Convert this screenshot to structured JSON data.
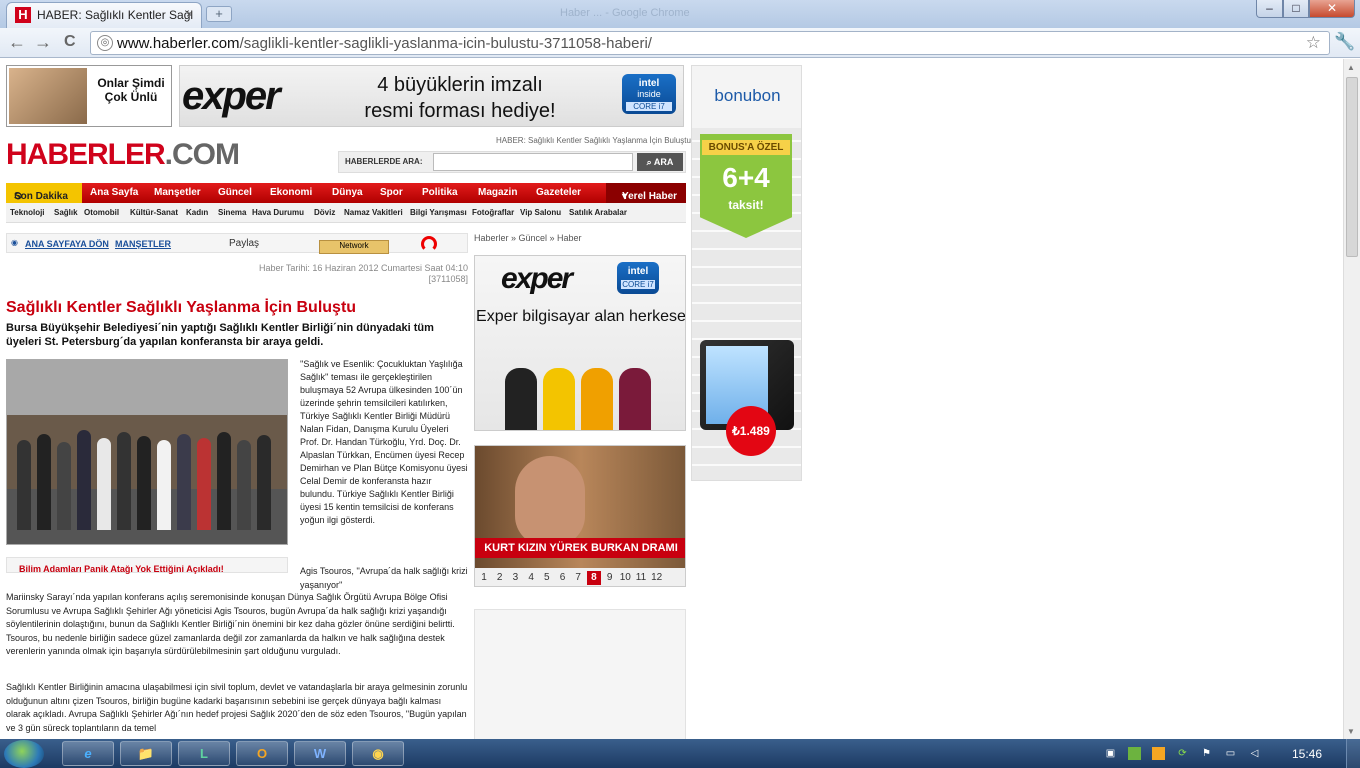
{
  "browser": {
    "tab_title": "HABER: Sağlıklı Kentler Sağl",
    "tab_close": "×",
    "new_tab": "+",
    "window_ghost_title": "Haber ... - Google Chrome",
    "url_host": "www.haberler.com",
    "url_path": "/saglikli-kentler-saglikli-yaslanma-icin-bulustu-3711058-haberi/",
    "back": "←",
    "forward": "→",
    "reload": "C",
    "star": "☆",
    "wrench": "🔧",
    "minimize": "–",
    "maximize": "□",
    "close": "✕"
  },
  "ads": {
    "baby_text": "Onlar Şimdi Çok Ünlü",
    "exper_logo": "exper",
    "exper_top_slogan": "4 büyüklerin imzalı resmi forması hediye!",
    "intel_brand": "intel",
    "intel_inside": "inside",
    "intel_core": "CORE i7",
    "bonubon_logo": "bonubon",
    "bonus_label": "BONUS'A ÖZEL",
    "bonus_num": "6+4",
    "bonus_sub": "taksit!",
    "price": "₺1.489",
    "exper_mid_slogan": "Exper bilgisayar alan herkese"
  },
  "header": {
    "crumb_top": "HABER: Sağlıklı Kentler Sağlıklı Yaşlanma İçin Buluştu",
    "logo_main": "HABERLER",
    "logo_dot": ".COM",
    "search_label": "HABERLERDE ARA:",
    "search_value": "",
    "search_button": "ARA"
  },
  "nav": {
    "breaking": "Son Dakika",
    "items": [
      "Ana Sayfa",
      "Manşetler",
      "Güncel",
      "Ekonomi",
      "Dünya",
      "Spor",
      "Politika",
      "Magazin",
      "Gazeteler"
    ],
    "local": "Yerel Haber",
    "sub_items": [
      "Teknoloji",
      "Sağlık",
      "Otomobil",
      "Kültür-Sanat",
      "Kadın",
      "Sinema",
      "Hava Durumu",
      "Döviz",
      "Namaz Vakitleri",
      "Bilgi Yarışması",
      "Fotoğraflar",
      "Vip Salonu",
      "Satılık Arabalar"
    ]
  },
  "article": {
    "back_home": "ANA SAYFAYA DÖN",
    "headlines_link": "MANŞETLER",
    "share": "Paylaş",
    "share_widget": "Network",
    "date": "Haber Tarihi: 16 Haziran 2012 Cumartesi Saat 04:10",
    "id": "[3711058]",
    "title": "Sağlıklı Kentler Sağlıklı Yaşlanma İçin Buluştu",
    "summary": "Bursa Büyükşehir Belediyesi´nin yaptığı Sağlıklı Kentler Birliği´nin dünyadaki tüm üyeleri St. Petersburg´da yapılan konferansta bir araya geldi.",
    "related": "Bilim Adamları Panik Atağı Yok Ettiğini Açıkladı!",
    "p1": "''Sağlık ve Esenlik: Çocukluktan Yaşlılığa Sağlık'' teması ile gerçekleştirilen buluşmaya 52 Avrupa ülkesinden 100´ün üzerinde şehrin temsilcileri katılırken, Türkiye Sağlıklı Kentler Birliği Müdürü Nalan Fidan, Danışma Kurulu Üyeleri Prof. Dr. Handan Türkoğlu, Yrd. Doç. Dr. Alpaslan Türkkan, Encümen üyesi Recep Demirhan ve Plan Bütçe Komisyonu üyesi Celal Demir de konferansta hazır bulundu. Türkiye Sağlıklı Kentler Birliği üyesi 15 kentin temsilcisi de konferans yoğun ilgi gösterdi.",
    "p2a": "Agis Tsouros, ''Avrupa´da halk sağlığı krizi yaşanıyor''",
    "p2b": "Mariinsky Sarayı´nda yapılan konferans açılış seremonisinde konuşan Dünya Sağlık Örgütü Avrupa Bölge Ofisi Sorumlusu ve Avrupa Sağlıklı Şehirler Ağı yöneticisi Agis Tsouros, bugün Avrupa´da halk sağlığı krizi yaşandığı söylentilerinin dolaştığını, bunun da Sağlıklı Kentler Birliği´nin önemini bir kez daha gözler önüne serdiğini belirtti. Tsouros, bu nedenle birliğin sadece güzel zamanlarda değil zor zamanlarda da halkın ve halk sağlığına destek verenlerin yanında olmak için başarıyla sürdürülebilmesinin şart olduğunu vurguladı.",
    "p3": "Sağlıklı Kentler Birliğinin amacına ulaşabilmesi için sivil toplum, devlet ve vatandaşlarla bir araya gelmesinin zorunlu olduğunun altını çizen Tsouros, birliğin bugüne kadarki başarısının sebebini ise gerçek dünyaya bağlı kalması olarak açıkladı. Avrupa Sağlıklı Şehirler Ağı´nın hedef projesi Sağlık 2020´den de söz eden Tsouros, \"Bugün yapılan ve 3 gün süreck toplantıların da temel"
  },
  "middle": {
    "crumb": "Haberler » Güncel » Haber",
    "gallery_caption": "KURT KIZIN YÜREK BURKAN DRAMI",
    "pages": [
      "1",
      "2",
      "3",
      "4",
      "5",
      "6",
      "7",
      "8",
      "9",
      "10",
      "11",
      "12"
    ],
    "active_page": "8"
  },
  "taskbar": {
    "clock": "15:46",
    "apps": [
      "e",
      "📁",
      "L",
      "O",
      "W",
      "◉"
    ]
  },
  "colors": {
    "brand_red": "#d0021b",
    "nav_red": "#c8000f",
    "breaking_yellow": "#f4c400",
    "link_blue": "#1a4f9a"
  }
}
